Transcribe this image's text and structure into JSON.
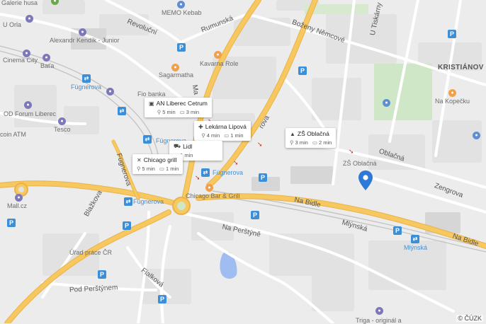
{
  "colors": {
    "background": "#ececec",
    "block": "#e3e3e3",
    "block_dark": "#dadada",
    "park": "#cfe6c7",
    "water": "#9fbdf1",
    "road_main": "#f6c85f",
    "road_main_border": "#e9b34a",
    "road_minor": "#ffffff",
    "rail": "#bdbdbd",
    "marker": "#2d79d8"
  },
  "streets": {
    "revolucni": "Revoluční",
    "rumunska": "Rumunská",
    "bozeny_nemcove": "Boženy Němcové",
    "u_tiskarny": "U Tiskárny",
    "masarykova": "Ma",
    "na_rybnicku": "rova",
    "fugnerova_1": "Fügnerova",
    "fugnerova_2": "Fügnerova",
    "fugnerova_3": "Fügnerova",
    "blazkova": "Blažkova",
    "na_bidle_1": "Na Bidle",
    "na_bidle_2": "Na Bidle",
    "na_perstyne": "Na Perštýně",
    "mlynska": "Mlýnská",
    "oblacna": "Oblačná",
    "zengrova": "Zengrova",
    "fialkova": "Fialková",
    "pod_perstynem": "Pod Perštýnem"
  },
  "places": {
    "galerie": "Galerie husa",
    "memo": "MEMO Kebab",
    "u_orla": "U Orla",
    "alexandr": "Alexandr Kendík - Junior",
    "cinema": "Cinema City",
    "bafa": "Baťa",
    "kavarna": "Kavarna Role",
    "sagarmatha": "Sagarmatha",
    "fugnerova_stop": "Fügnerova",
    "fio": "Fio banka",
    "od_forum": "OD Forum Liberec",
    "tesco": "Tesco",
    "atm": "coin ATM",
    "kristianov": "KRISTIÁNOV",
    "na_kopecku": "Na Kopečku",
    "zs_oblacna_label": "ZŠ Oblačná",
    "chicago_bar": "Chicago Bar & Grill",
    "mall": "Mall.cz",
    "urad": "Úřad práce ČR",
    "mlynska_stop": "Mlýnská",
    "triga": "Triga - originál a"
  },
  "cards": {
    "an_liberec": {
      "title": "AN Liberec Cetrum",
      "walk": "5 min",
      "car": "3 min",
      "icon": "bus"
    },
    "lekarna": {
      "title": "Lekárna Lipová",
      "walk": "4 min",
      "car": "1 min",
      "icon": "pharmacy"
    },
    "lidl": {
      "title": "Lidl",
      "walk": "",
      "car": "1 min",
      "icon": "cart"
    },
    "chicago": {
      "title": "Chicago grill",
      "walk": "5 min",
      "car": "1 min",
      "icon": "restaurant"
    },
    "zs_oblacna": {
      "title": "ZŠ Oblačná",
      "walk": "3 min",
      "car": "2 min",
      "icon": "school"
    }
  },
  "icons": {
    "parking": "P",
    "transit": "⇄",
    "walk": "🚶",
    "car": "🚗"
  },
  "credit": "© ČÚZK"
}
